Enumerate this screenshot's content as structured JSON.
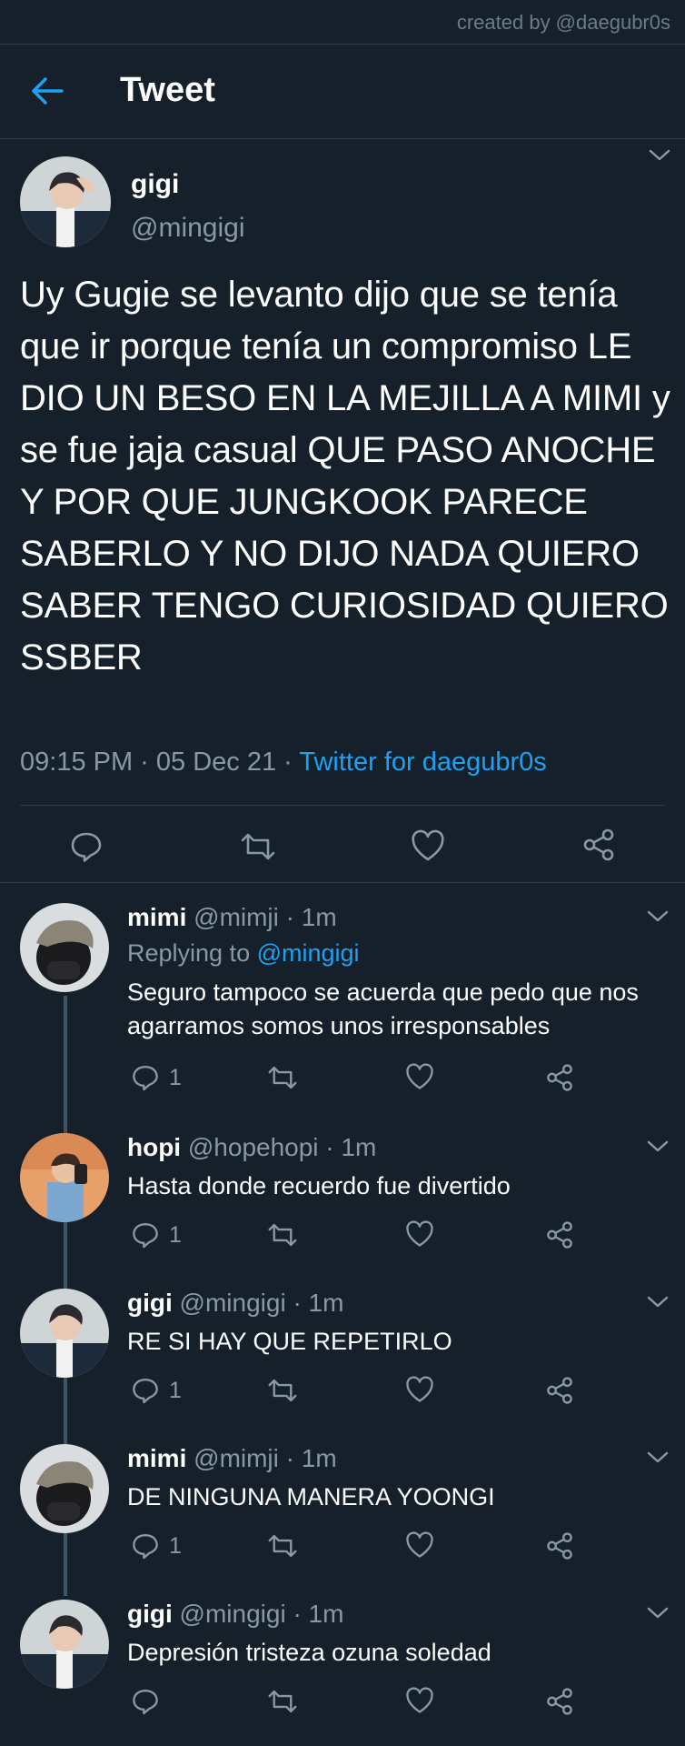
{
  "credit": "created by @daegubr0s",
  "header": {
    "title": "Tweet"
  },
  "main_tweet": {
    "name": "gigi",
    "handle": "@mingigi",
    "text": "Uy Gugie se levanto dijo que se tenía que ir porque tenía un compromiso LE DIO UN BESO EN LA MEJILLA A MIMI y se fue jaja casual QUE PASO ANOCHE Y POR QUE JUNGKOOK PARECE SABERLO Y NO DIJO NADA QUIERO SABER TENGO CURIOSIDAD QUIERO SSBER",
    "time": "09:15 PM · 05 Dec 21 · ",
    "source": "Twitter for daegubr0s"
  },
  "replies": [
    {
      "name": "mimi",
      "handle": "@mimji · 1m",
      "replying_prefix": "Replying to ",
      "replying_to": "@mingigi",
      "text": "Seguro tampoco se acuerda que pedo que nos agarramos somos unos irresponsables",
      "reply_count": "1"
    },
    {
      "name": "hopi",
      "handle": "@hopehopi · 1m",
      "text": "Hasta donde recuerdo fue divertido",
      "reply_count": "1"
    },
    {
      "name": "gigi",
      "handle": "@mingigi · 1m",
      "text": "RE SI HAY QUE REPETIRLO",
      "reply_count": "1"
    },
    {
      "name": "mimi",
      "handle": "@mimji · 1m",
      "text": "DE NINGUNA MANERA YOONGI",
      "reply_count": "1"
    },
    {
      "name": "gigi",
      "handle": "@mingigi · 1m",
      "text": "Depresión tristeza ozuna soledad",
      "reply_count": ""
    }
  ],
  "icons": [
    "back-arrow-icon",
    "chevron-down-icon",
    "reply-icon",
    "retweet-icon",
    "like-icon",
    "share-icon"
  ],
  "colors": {
    "background": "#15202b",
    "accent": "#1da1f2",
    "muted": "#8899a6",
    "thread_line": "#3d5466"
  }
}
